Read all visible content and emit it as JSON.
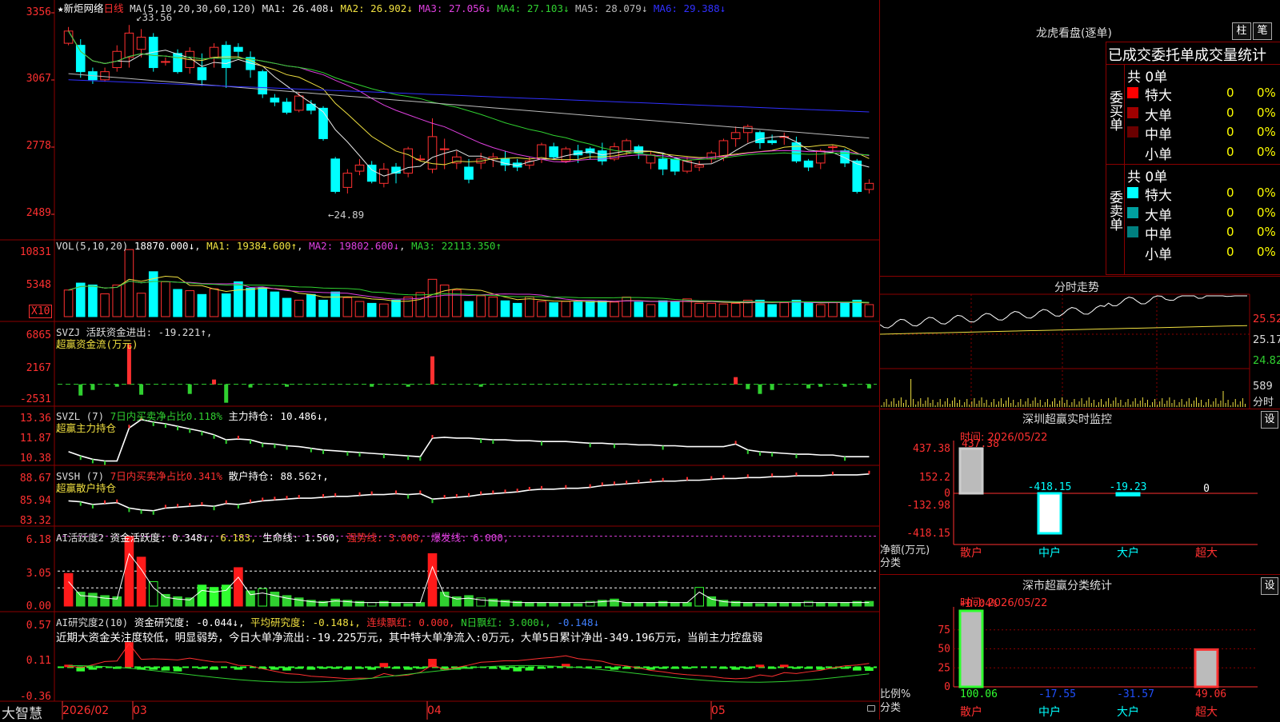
{
  "main": {
    "stock_name": "新炬网络",
    "period": "日线",
    "ma_header": "MA(5,10,20,30,60,120)",
    "ma_values": [
      {
        "label": "MA1:",
        "value": "26.408↓",
        "color": "#e6e6e6"
      },
      {
        "label": "MA2:",
        "value": "26.902↓",
        "color": "#f0e040"
      },
      {
        "label": "MA3:",
        "value": "27.056↓",
        "color": "#e040e0"
      },
      {
        "label": "MA4:",
        "value": "27.103↓",
        "color": "#30d030"
      },
      {
        "label": "MA5:",
        "value": "28.079↓",
        "color": "#bbbbbb"
      },
      {
        "label": "MA6:",
        "value": "29.388↓",
        "color": "#3030ff"
      }
    ],
    "y_ticks": [
      "3356",
      "3067",
      "2778",
      "2489"
    ],
    "high_label": "33.56",
    "low_label": "24.89"
  },
  "vol": {
    "header": "VOL(5,10,20)",
    "value": "18870.000↓",
    "ma1": "MA1: 19384.600↑",
    "ma2": "MA2: 19802.600↓",
    "ma3": "MA3: 22113.350↑",
    "y_ticks": [
      "10831",
      "5348"
    ],
    "unit": "X10"
  },
  "svzj": {
    "header": "SVZJ  活跃资金进出: -19.221↑,",
    "subtitle": "超赢资金流(万元)",
    "y_ticks": [
      "6865",
      "2167",
      "-2531"
    ]
  },
  "svzl": {
    "header_a": "SVZL (7)",
    "header_b": "7日内买卖净占比0.118%",
    "header_c": "主力持仓: 10.486↓,",
    "subtitle": "超赢主力持仓",
    "y_ticks": [
      "13.36",
      "11.87",
      "10.38"
    ]
  },
  "svsh": {
    "header_a": "SVSH (7)",
    "header_b": "7日内买卖净占比0.341%",
    "header_c": "散户持仓: 88.562↑,",
    "subtitle": "超赢散户持仓",
    "y_ticks": [
      "88.67",
      "85.94",
      "83.32"
    ]
  },
  "ai1": {
    "header_a": "AI活跃度2",
    "header_b": "资金活跃度: 0.348↓,",
    "header_c": "6.183,",
    "header_d": "生命线: 1.560,",
    "header_e": "强势线: 3.000,",
    "header_f": "爆发线: 6.000,",
    "y_ticks": [
      "6.18",
      "3.05",
      "0.00"
    ]
  },
  "ai2": {
    "header_a": "AI研究度2(10)",
    "header_b": "资金研究度: -0.044↓,",
    "header_c": "平均研究度: -0.148↓,",
    "header_d": "连续飘红: 0.000,",
    "header_e": "N日飘红: 3.000↓,",
    "header_f": "-0.148↓",
    "comment": "近期大资金关注度较低，明显弱势，今日大单净流出:-19.225万元，其中特大单净流入:0万元，大单5日累计净出-349.196万元，当前主力控盘弱",
    "y_ticks": [
      "0.57",
      "0.11",
      "-0.36"
    ]
  },
  "bottom": {
    "brand": "大智慧",
    "dates": [
      "2026/02",
      "03",
      "04",
      "05"
    ]
  },
  "right": {
    "dragon_title": "龙虎看盘(逐单)",
    "btn_bar": "柱",
    "btn_pen": "笔",
    "stat_title": "已成交委托单成交量统计",
    "buy_label": "委买单",
    "sell_label": "委卖单",
    "buy_total": "共 0单",
    "sell_total": "共 0单",
    "buy_rows": [
      {
        "name": "特大",
        "count": "0",
        "pct": "0%",
        "color": "#ff0000"
      },
      {
        "name": "大单",
        "count": "0",
        "pct": "0%",
        "color": "#a00000"
      },
      {
        "name": "中单",
        "count": "0",
        "pct": "0%",
        "color": "#6a0000"
      },
      {
        "name": "小单",
        "count": "0",
        "pct": "0%",
        "color": "#000000"
      }
    ],
    "sell_rows": [
      {
        "name": "特大",
        "count": "0",
        "pct": "0%",
        "color": "#00ffff"
      },
      {
        "name": "大单",
        "count": "0",
        "pct": "0%",
        "color": "#00a0a0"
      },
      {
        "name": "中单",
        "count": "0",
        "pct": "0%",
        "color": "#008080"
      },
      {
        "name": "小单",
        "count": "0",
        "pct": "0%",
        "color": "#000000"
      }
    ],
    "intraday_title": "分时走势",
    "intraday_ticks": [
      "25.52",
      "25.17",
      "24.82"
    ],
    "intraday_vol": "589",
    "intraday_unit": "分时",
    "monitor_title": "深圳超赢实时监控",
    "monitor_btn": "设",
    "monitor_time": "时间: 2026/05/22",
    "monitor_ticks": [
      "437.38",
      "152.2",
      "0",
      "-132.98",
      "-418.15"
    ],
    "monitor_ylabel_a": "净额(万元)",
    "monitor_ylabel_b": "分类",
    "classify_title": "深市超赢分类统计",
    "classify_btn": "设",
    "classify_time": "时间: 2026/05/22",
    "classify_top": "+0.04%",
    "classify_ticks": [
      "75",
      "50",
      "25",
      "0"
    ],
    "classify_ylabel_a": "比例%",
    "classify_ylabel_b": "分类",
    "categories": [
      "散户",
      "中户",
      "大户",
      "超大"
    ]
  },
  "chart_data": [
    {
      "type": "candlestick",
      "title": "新炬网络 日线",
      "ylim": [
        24.0,
        34.2
      ],
      "annotations": {
        "high": 33.56,
        "low": 24.89
      },
      "x_labels": [
        "2026/02",
        "03",
        "04",
        "05"
      ],
      "candles": [
        [
          32.7,
          33.3,
          32.6,
          33.5
        ],
        [
          32.6,
          31.3,
          31.0,
          32.9
        ],
        [
          31.3,
          30.9,
          30.7,
          31.5
        ],
        [
          30.9,
          31.3,
          30.8,
          31.5
        ],
        [
          31.5,
          32.3,
          31.3,
          32.6
        ],
        [
          32.0,
          33.2,
          31.5,
          33.6
        ],
        [
          32.4,
          33.0,
          32.0,
          33.4
        ],
        [
          33.0,
          31.5,
          31.3,
          33.2
        ],
        [
          31.8,
          31.8,
          31.6,
          32.0
        ],
        [
          32.2,
          31.3,
          31.2,
          32.4
        ],
        [
          31.5,
          32.3,
          31.2,
          32.5
        ],
        [
          31.5,
          30.9,
          30.6,
          32.2
        ],
        [
          32.0,
          32.5,
          31.5,
          32.7
        ],
        [
          32.6,
          31.5,
          30.5,
          32.8
        ],
        [
          32.5,
          32.3,
          32.0,
          32.7
        ],
        [
          32.0,
          31.4,
          31.0,
          32.3
        ],
        [
          31.3,
          30.2,
          30.0,
          31.4
        ],
        [
          30.0,
          29.8,
          29.6,
          30.2
        ],
        [
          29.8,
          29.3,
          29.2,
          30.0
        ],
        [
          29.4,
          30.1,
          29.3,
          30.3
        ],
        [
          29.7,
          29.4,
          29.2,
          29.9
        ],
        [
          29.5,
          28.0,
          27.9,
          29.6
        ],
        [
          27.0,
          25.4,
          25.3,
          27.1
        ],
        [
          25.6,
          26.3,
          25.3,
          26.5
        ],
        [
          26.4,
          26.7,
          26.2,
          27.0
        ],
        [
          26.7,
          25.9,
          25.8,
          26.9
        ],
        [
          25.8,
          26.5,
          25.6,
          26.8
        ],
        [
          26.6,
          26.3,
          25.8,
          26.8
        ],
        [
          26.3,
          27.5,
          26.1,
          27.6
        ],
        [
          27.0,
          27.0,
          26.9,
          27.2
        ],
        [
          26.5,
          28.1,
          26.3,
          29.0
        ],
        [
          27.5,
          27.5,
          26.5,
          28.0
        ],
        [
          26.8,
          27.1,
          26.5,
          27.4
        ],
        [
          26.6,
          26.0,
          25.8,
          27.0
        ],
        [
          26.8,
          27.0,
          26.5,
          27.3
        ],
        [
          27.0,
          27.1,
          26.6,
          27.3
        ],
        [
          27.0,
          26.7,
          26.4,
          27.4
        ],
        [
          26.8,
          26.6,
          26.4,
          27.0
        ],
        [
          26.7,
          26.9,
          26.5,
          27.1
        ],
        [
          27.0,
          27.7,
          26.8,
          27.8
        ],
        [
          27.6,
          27.1,
          27.0,
          27.8
        ],
        [
          26.9,
          27.5,
          26.8,
          27.6
        ],
        [
          27.4,
          27.2,
          26.8,
          27.7
        ],
        [
          27.5,
          27.3,
          27.0,
          27.6
        ],
        [
          27.4,
          26.9,
          26.7,
          27.8
        ],
        [
          27.0,
          27.6,
          26.9,
          27.8
        ],
        [
          27.4,
          27.9,
          27.2,
          28.0
        ],
        [
          27.6,
          27.3,
          27.0,
          27.7
        ],
        [
          26.8,
          27.2,
          26.5,
          27.4
        ],
        [
          27.0,
          26.5,
          26.2,
          27.3
        ],
        [
          27.0,
          26.4,
          26.2,
          27.1
        ],
        [
          26.4,
          26.9,
          26.3,
          27.1
        ],
        [
          26.6,
          26.7,
          26.4,
          26.9
        ],
        [
          27.0,
          27.3,
          26.8,
          27.4
        ],
        [
          27.1,
          27.9,
          26.9,
          28.0
        ],
        [
          28.0,
          28.3,
          27.6,
          28.6
        ],
        [
          28.3,
          28.6,
          27.8,
          28.7
        ],
        [
          28.3,
          27.8,
          27.5,
          28.4
        ],
        [
          27.9,
          27.8,
          27.7,
          28.2
        ],
        [
          28.1,
          28.1,
          27.7,
          28.3
        ],
        [
          27.8,
          26.9,
          26.8,
          28.1
        ],
        [
          26.9,
          26.6,
          26.4,
          27.0
        ],
        [
          26.8,
          27.4,
          26.5,
          27.5
        ],
        [
          27.6,
          27.6,
          27.3,
          27.7
        ],
        [
          27.4,
          26.8,
          26.6,
          27.5
        ],
        [
          26.9,
          25.4,
          25.3,
          27.0
        ],
        [
          25.5,
          25.8,
          25.3,
          26.0
        ]
      ]
    },
    {
      "type": "bar",
      "title": "VOL(5,10,20)",
      "unit": "X10",
      "ylim": [
        0,
        11500
      ],
      "values": [
        4200,
        5300,
        5000,
        3600,
        5000,
        10600,
        3700,
        7100,
        5500,
        4300,
        4100,
        3500,
        4400,
        3600,
        5500,
        4500,
        4600,
        3900,
        2900,
        2600,
        3500,
        2600,
        3900,
        3000,
        2400,
        2100,
        2000,
        2600,
        3100,
        3800,
        5900,
        5000,
        4200,
        2400,
        3300,
        3100,
        2500,
        2100,
        3100,
        2400,
        2200,
        2400,
        2300,
        2400,
        2500,
        2300,
        3100,
        2300,
        1900,
        2500,
        2400,
        2800,
        2100,
        2100,
        2000,
        2100,
        2600,
        2600,
        1900,
        2200,
        2600,
        2200,
        1900,
        2200,
        2200,
        2600,
        1900
      ]
    },
    {
      "type": "bar",
      "title": "超赢资金流(万元)",
      "ylim": [
        -2531,
        6865
      ],
      "values": [
        0,
        -1400,
        -700,
        0,
        -300,
        5000,
        -1300,
        0,
        0,
        0,
        -1200,
        0,
        600,
        -2300,
        0,
        -400,
        0,
        0,
        -300,
        0,
        0,
        0,
        0,
        0,
        0,
        -300,
        0,
        0,
        -300,
        0,
        3500,
        0,
        0,
        0,
        -300,
        0,
        0,
        0,
        0,
        0,
        0,
        0,
        0,
        0,
        0,
        0,
        0,
        0,
        0,
        0,
        -200,
        0,
        0,
        0,
        0,
        900,
        -600,
        -1200,
        -700,
        0,
        0,
        -500,
        -300,
        0,
        -300,
        0,
        -500
      ]
    },
    {
      "type": "line",
      "title": "超赢主力持仓",
      "ylim": [
        10.38,
        13.36
      ],
      "values": [
        11.0,
        10.75,
        10.55,
        10.45,
        10.45,
        12.4,
        12.9,
        12.75,
        12.65,
        12.5,
        12.35,
        12.2,
        12.0,
        11.7,
        11.75,
        11.7,
        11.5,
        11.45,
        11.35,
        11.3,
        11.2,
        11.1,
        11.05,
        11.0,
        10.95,
        10.9,
        10.85,
        10.8,
        10.75,
        10.7,
        11.8,
        11.85,
        11.8,
        11.8,
        11.75,
        11.7,
        11.7,
        11.65,
        11.65,
        11.6,
        11.6,
        11.6,
        11.55,
        11.5,
        11.5,
        11.45,
        11.45,
        11.4,
        11.4,
        11.35,
        11.35,
        11.3,
        11.3,
        11.3,
        11.3,
        11.45,
        11.1,
        11.0,
        10.95,
        10.9,
        10.85,
        10.85,
        10.8,
        10.8,
        10.7,
        10.7,
        10.7
      ]
    },
    {
      "type": "line",
      "title": "超赢散户持仓",
      "ylim": [
        83.32,
        88.67
      ],
      "values": [
        85.6,
        85.5,
        85.2,
        85.3,
        85.4,
        84.8,
        84.6,
        84.5,
        84.8,
        84.9,
        85.0,
        85.1,
        85.0,
        85.3,
        85.2,
        85.4,
        85.6,
        85.7,
        85.8,
        85.9,
        85.9,
        86.0,
        86.1,
        86.1,
        86.2,
        86.3,
        86.3,
        86.4,
        86.3,
        86.4,
        85.8,
        85.9,
        86.0,
        86.1,
        86.3,
        86.4,
        86.5,
        86.6,
        86.8,
        86.9,
        86.9,
        87.0,
        87.0,
        87.1,
        87.3,
        87.4,
        87.5,
        87.6,
        87.7,
        87.8,
        87.8,
        87.9,
        87.9,
        88.0,
        88.1,
        88.1,
        88.2,
        88.2,
        88.3,
        88.3,
        88.4,
        88.4,
        88.4,
        88.5,
        88.5,
        88.5,
        88.6
      ]
    },
    {
      "type": "bar",
      "title": "AI活跃度2",
      "ylim": [
        0,
        6.18
      ],
      "values": [
        2.8,
        1.2,
        1.1,
        0.9,
        0.8,
        6.0,
        4.2,
        2.1,
        1.0,
        0.8,
        0.7,
        1.8,
        1.6,
        1.8,
        3.3,
        1.3,
        1.5,
        1.2,
        0.9,
        0.7,
        0.5,
        0.4,
        0.6,
        0.5,
        0.4,
        0.3,
        0.4,
        0.3,
        0.2,
        0.3,
        4.5,
        1.2,
        0.8,
        0.9,
        0.7,
        0.6,
        0.5,
        0.4,
        0.3,
        0.3,
        0.3,
        0.3,
        0.2,
        0.4,
        0.5,
        0.6,
        0.3,
        0.3,
        0.3,
        0.4,
        0.3,
        0.3,
        1.6,
        0.8,
        0.5,
        0.4,
        0.3,
        0.2,
        0.3,
        0.3,
        0.3,
        0.4,
        0.3,
        0.3,
        0.3,
        0.4,
        0.4
      ]
    },
    {
      "type": "bar",
      "title": "AI研究度2(10)",
      "ylim": [
        -0.36,
        0.57
      ],
      "values": [
        0.03,
        -0.05,
        -0.03,
        0.0,
        -0.02,
        0.3,
        -0.03,
        -0.03,
        -0.04,
        -0.05,
        0.0,
        -0.02,
        -0.03,
        0.0,
        -0.03,
        0.0,
        -0.02,
        -0.03,
        -0.04,
        -0.02,
        -0.03,
        -0.02,
        -0.02,
        -0.03,
        -0.02,
        -0.03,
        0.05,
        -0.02,
        -0.03,
        -0.01,
        0.1,
        -0.03,
        -0.03,
        -0.02,
        0.0,
        -0.02,
        -0.03,
        -0.05,
        -0.04,
        -0.02,
        0.0,
        0.04,
        0.0,
        0.0,
        0.0,
        -0.03,
        -0.02,
        -0.02,
        -0.03,
        -0.02,
        -0.02,
        -0.01,
        0.0,
        0.0,
        -0.02,
        -0.03,
        -0.02,
        0.03,
        -0.02,
        0.03,
        -0.02,
        -0.02,
        -0.03,
        -0.02,
        -0.02,
        -0.04,
        -0.044
      ]
    },
    {
      "type": "bar",
      "title": "深圳超赢实时监控",
      "categories": [
        "散户",
        "中户",
        "大户",
        "超大"
      ],
      "values": [
        437.38,
        -418.15,
        -19.23,
        0
      ],
      "ylim": [
        -418.15,
        437.38
      ]
    },
    {
      "type": "bar",
      "title": "深市超赢分类统计",
      "categories": [
        "散户",
        "中户",
        "大户",
        "超大"
      ],
      "values": [
        100.06,
        -17.55,
        -31.57,
        49.06
      ],
      "ylim": [
        0,
        100
      ]
    }
  ]
}
